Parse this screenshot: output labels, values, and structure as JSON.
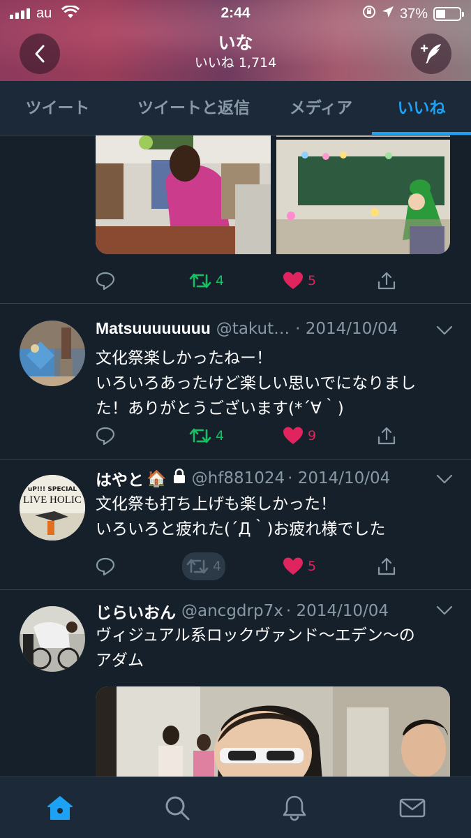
{
  "status_bar": {
    "carrier": "au",
    "time": "2:44",
    "battery": "37%",
    "battery_level": 0.37
  },
  "header": {
    "name": "いな",
    "likes_label": "いいね 1,714"
  },
  "tabs": [
    {
      "label": "ツイート",
      "active": false
    },
    {
      "label": "ツイートと返信",
      "active": false
    },
    {
      "label": "メディア",
      "active": false
    },
    {
      "label": "いいね",
      "active": true
    }
  ],
  "tweets": [
    {
      "retweets": "4",
      "likes": "5"
    },
    {
      "name": "Matsuuuuuuuu",
      "handle": "@takut…",
      "date": "· 2014/10/04",
      "text_lines": [
        "文化祭楽しかったねー！",
        "いろいろあったけど楽しい思いでになりまし",
        "た！ありがとうございます(*´∀｀)"
      ],
      "retweets": "4",
      "likes": "9"
    },
    {
      "name": "はやと",
      "emoji": "🏠",
      "handle": "@hf881024",
      "date": "· 2014/10/04",
      "text_lines": [
        "文化祭も打ち上げも楽しかった！",
        "いろいろと疲れた(´Д｀)お疲れ様でした"
      ],
      "retweets": "4",
      "likes": "5",
      "avatar_text": [
        "uP!!! SPECIAL",
        "LIVE HOLIC"
      ]
    },
    {
      "name": "じらいおん",
      "handle": "@ancgdrp7x",
      "date": "· 2014/10/04",
      "text_lines": [
        "ヴィジュアル系ロックヴァンド〜エデン〜の",
        "アダム"
      ]
    }
  ],
  "bottom_nav": [
    "home-icon",
    "search-icon",
    "notifications-icon",
    "messages-icon"
  ],
  "colors": {
    "background": "#15202b",
    "accent": "#1da1f2",
    "retweet": "#17bf63",
    "like": "#e0245e",
    "muted": "#8899a6"
  }
}
